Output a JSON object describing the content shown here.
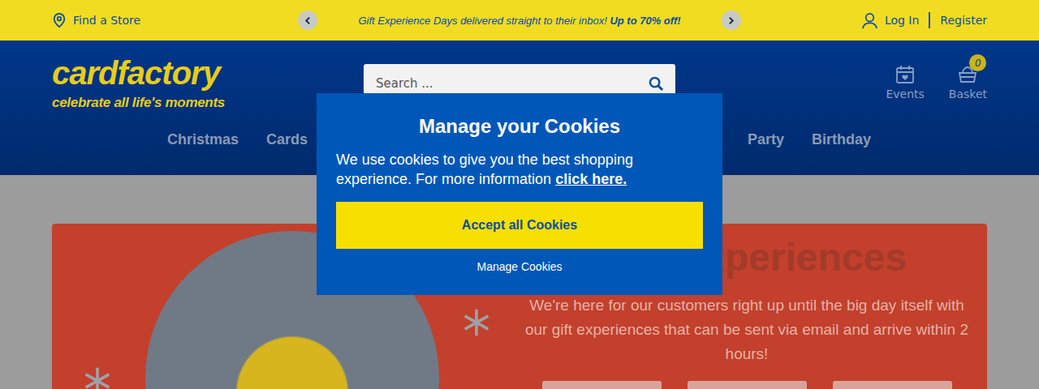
{
  "top_bar": {
    "find_store": "Find a Store",
    "promo": {
      "text": "Gift Experience Days delivered straight to their inbox!",
      "highlight": "Up to 70% off!"
    },
    "login": "Log In",
    "register": "Register"
  },
  "logo": {
    "name": "cardfactory",
    "tagline": "celebrate all life's moments"
  },
  "search": {
    "placeholder": "Search ..."
  },
  "header_actions": [
    {
      "label": "Events",
      "kind": "events"
    },
    {
      "label": "Basket",
      "kind": "basket",
      "badge": "0"
    }
  ],
  "nav": {
    "left": [
      "Christmas",
      "Cards"
    ],
    "right": [
      "Party",
      "Birthday"
    ]
  },
  "hero": {
    "heading": "xperiences",
    "text": "We're here for our customers right up until the big day itself with our gift experiences that can be sent via email and arrive within 2 hours!"
  },
  "cookie_modal": {
    "title": "Manage your Cookies",
    "text": "We use cookies to give you the best shopping experience. For more information",
    "link": "click here.",
    "accept": "Accept all Cookies",
    "manage": "Manage Cookies"
  }
}
